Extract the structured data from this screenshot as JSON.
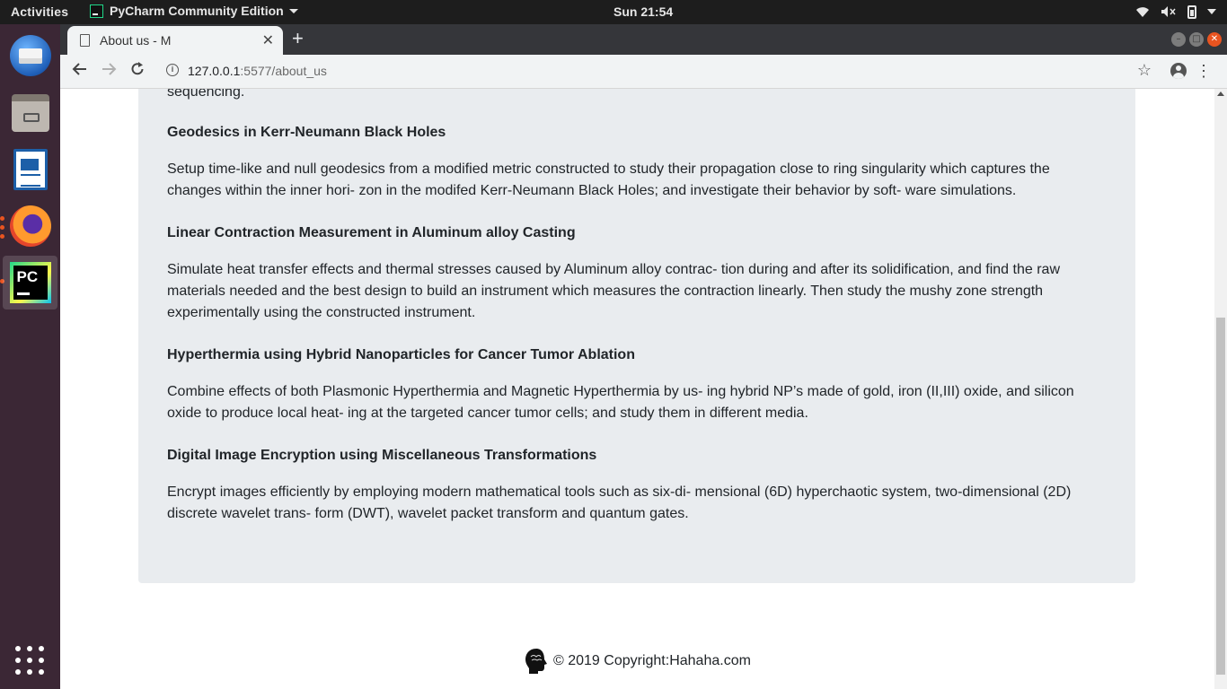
{
  "topbar": {
    "activities": "Activities",
    "app_name": "PyCharm Community Edition",
    "clock": "Sun 21:54"
  },
  "dock": {
    "items": [
      "thunderbird-icon",
      "files-icon",
      "libreoffice-writer-icon",
      "firefox-icon",
      "pycharm-icon"
    ],
    "active": "pycharm-icon"
  },
  "browser": {
    "tab_title": "About us - M",
    "url_host": "127.0.0.1",
    "url_path": ":5577/about_us"
  },
  "page": {
    "prev_tail": "sequencing.",
    "projects": [
      {
        "title": "Geodesics in Kerr-Neumann Black Holes",
        "description": "Setup time-like and null geodesics from a modified metric constructed to study their propagation close to ring singularity which captures the changes within the inner hori- zon in the modifed Kerr-Neumann Black Holes; and investigate their behavior by soft- ware simulations."
      },
      {
        "title": "Linear Contraction Measurement in Aluminum alloy Casting",
        "description": "Simulate heat transfer effects and thermal stresses caused by Aluminum alloy contrac- tion during and after its solidification, and find the raw materials needed and the best design to build an instrument which measures the contraction linearly. Then study the mushy zone strength experimentally using the constructed instrument."
      },
      {
        "title": "Hyperthermia using Hybrid Nanoparticles for Cancer Tumor Ablation",
        "description": "Combine effects of both Plasmonic Hyperthermia and Magnetic Hyperthermia by us- ing hybrid NP’s made of gold, iron (II,III) oxide, and silicon oxide to produce local heat- ing at the targeted cancer tumor cells; and study them in different media."
      },
      {
        "title": "Digital Image Encryption using Miscellaneous Transformations",
        "description": "Encrypt images efficiently by employing modern mathematical tools such as six-di- mensional (6D) hyperchaotic system, two-dimensional (2D) discrete wavelet trans- form (DWT), wavelet packet transform and quantum gates."
      }
    ],
    "footer": "© 2019 Copyright:Hahaha.com"
  },
  "colors": {
    "card_bg": "#e9ecef",
    "ubuntu_accent": "#e95420",
    "dock_bg": "#3b2735"
  }
}
